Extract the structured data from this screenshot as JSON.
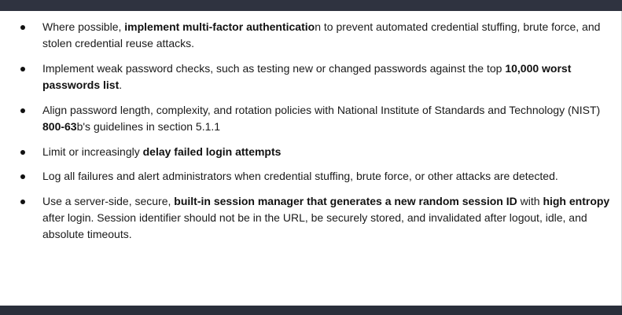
{
  "bullets": [
    {
      "segments": [
        {
          "text": "Where possible, ",
          "bold": false
        },
        {
          "text": "implement multi-factor authenticatio",
          "bold": true
        },
        {
          "text": "n to prevent automated credential stuffing, brute force, and stolen credential reuse attacks.",
          "bold": false
        }
      ]
    },
    {
      "segments": [
        {
          "text": "Implement weak password checks, such as testing new or changed passwords against the top ",
          "bold": false
        },
        {
          "text": "10,000 worst passwords list",
          "bold": true
        },
        {
          "text": ".",
          "bold": false
        }
      ]
    },
    {
      "segments": [
        {
          "text": "Align password length, complexity, and rotation policies with National Institute of Standards and Technology (NIST) ",
          "bold": false
        },
        {
          "text": "800-63",
          "bold": true
        },
        {
          "text": "b's guidelines in section 5.1.1",
          "bold": false
        }
      ]
    },
    {
      "segments": [
        {
          "text": "Limit or increasingly ",
          "bold": false
        },
        {
          "text": "delay failed login attempts",
          "bold": true
        }
      ]
    },
    {
      "segments": [
        {
          "text": "Log all failures and alert administrators when credential stuffing, brute force, or other attacks are detected.",
          "bold": false
        }
      ]
    },
    {
      "segments": [
        {
          "text": "Use a server-side, secure, ",
          "bold": false
        },
        {
          "text": "built-in session manager that generates a new random session ID",
          "bold": true
        },
        {
          "text": " with ",
          "bold": false
        },
        {
          "text": "high entropy",
          "bold": true
        },
        {
          "text": " after login. Session identifier should not be in the URL, be securely stored, and invalidated after logout, idle, and absolute timeouts.",
          "bold": false
        }
      ]
    }
  ]
}
